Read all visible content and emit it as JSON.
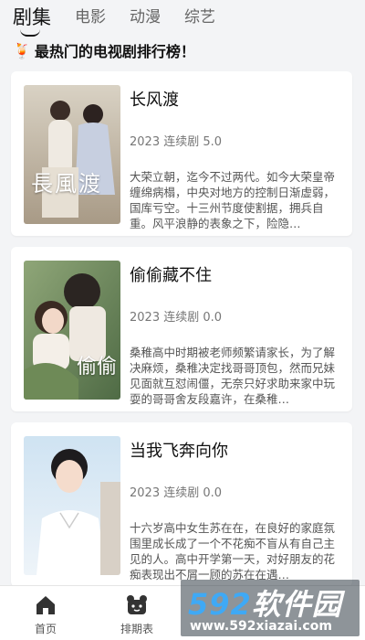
{
  "tabs": [
    {
      "label": "剧集",
      "active": true
    },
    {
      "label": "电影",
      "active": false
    },
    {
      "label": "动漫",
      "active": false
    },
    {
      "label": "综艺",
      "active": false
    }
  ],
  "heading": {
    "emoji": "🍹",
    "text": "最热门的电视剧排行榜！"
  },
  "shows": [
    {
      "title": "长风渡",
      "meta": "2023 连续剧 5.0",
      "desc": "大荣立朝，迄今不过两代。如今大荣皇帝缠绵病榻，中央对地方的控制日渐虚弱，国库亏空。十三州节度使割据，拥兵自重。风平浪静的表象之下，险隐…",
      "poster_text": "長風渡"
    },
    {
      "title": "偷偷藏不住",
      "meta": "2023 连续剧 0.0",
      "desc": "桑稚高中时期被老师频繁请家长，为了解决麻烦，桑稚决定找哥哥顶包，然而兄妹见面就互怼闹僵，无奈只好求助来家中玩耍的哥哥舍友段嘉许，在桑稚…",
      "poster_text": "偷偷"
    },
    {
      "title": "当我飞奔向你",
      "meta": "2023 连续剧 0.0",
      "desc": "十六岁高中女生苏在在，在良好的家庭氛围里成长成了一个不花痴不盲从有自己主见的人。高中开学第一天，对好朋友的花痴表现出不屑一顾的苏在在遇…",
      "poster_text": ""
    }
  ],
  "bottom_nav": [
    {
      "label": "首页",
      "icon": "home-icon"
    },
    {
      "label": "排期表",
      "icon": "schedule-icon"
    },
    {
      "label": "",
      "icon": ""
    },
    {
      "label": "",
      "icon": ""
    }
  ],
  "watermark": {
    "logo_num": "592",
    "logo_text": "软件园",
    "url": "www.592xiazai.com"
  }
}
